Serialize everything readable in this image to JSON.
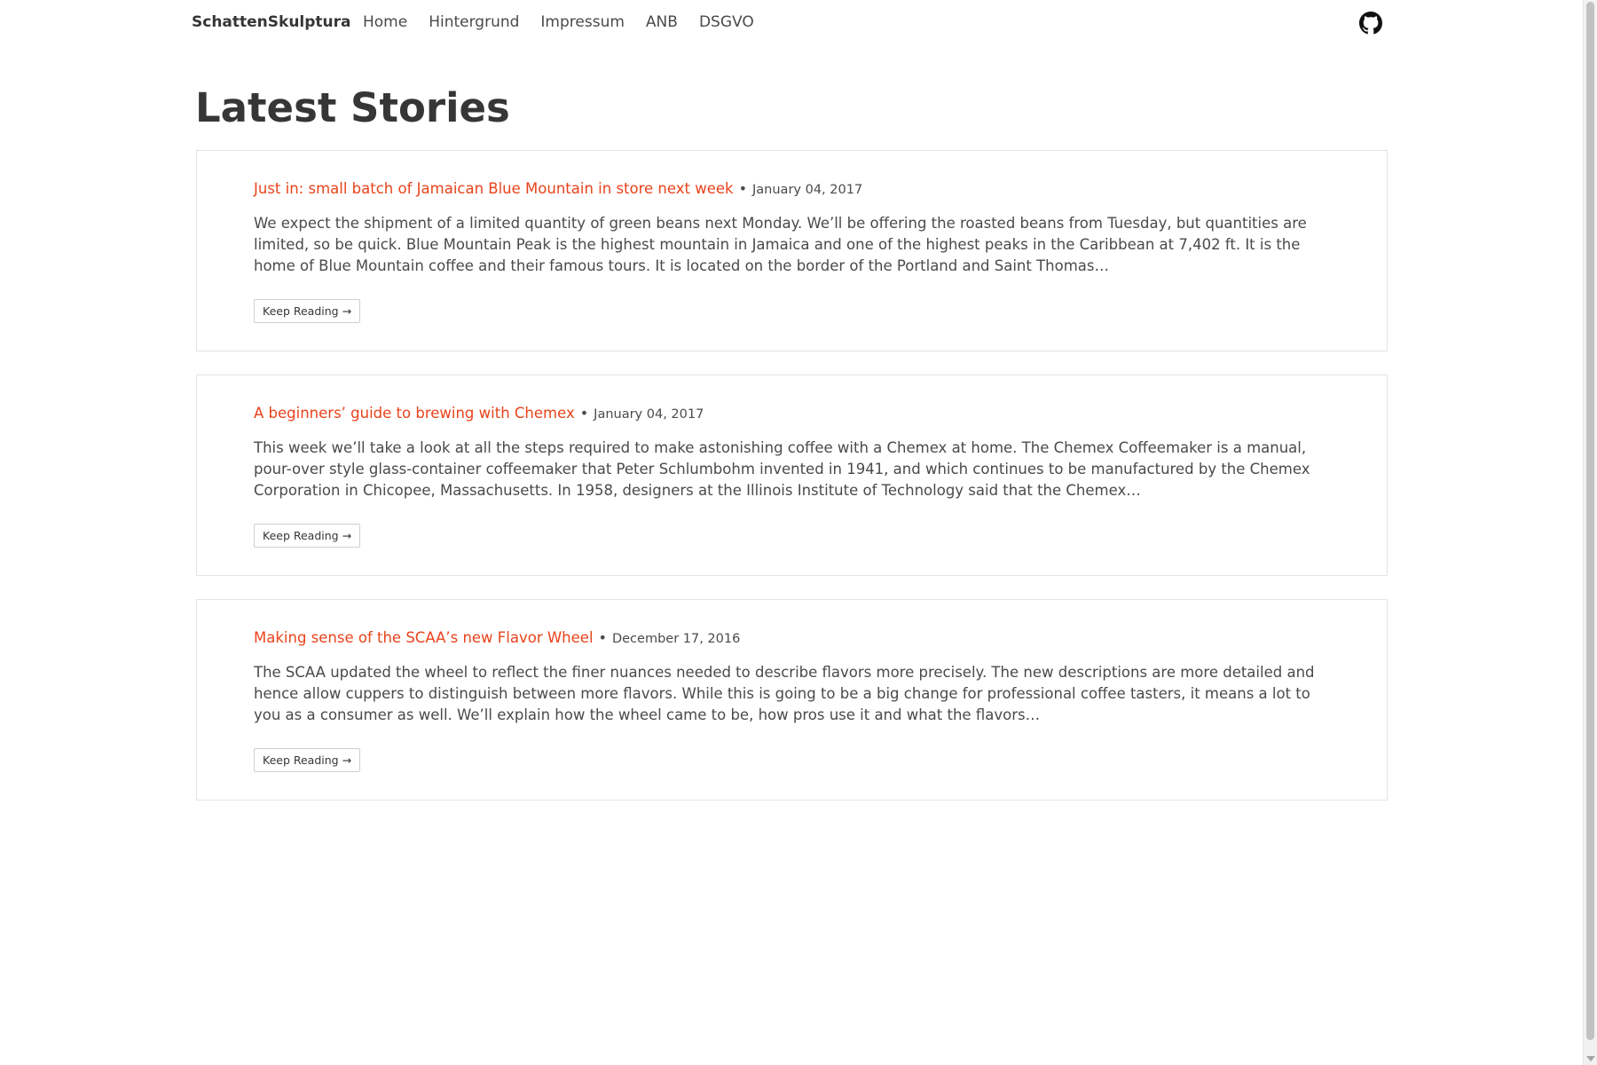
{
  "nav": {
    "brand": "SchattenSkulptura",
    "items": [
      {
        "label": "Home"
      },
      {
        "label": "Hintergrund"
      },
      {
        "label": "Impressum"
      },
      {
        "label": "ANB"
      },
      {
        "label": "DSGVO"
      }
    ],
    "github_icon": "github-icon"
  },
  "main": {
    "title": "Latest Stories",
    "posts": [
      {
        "title": "Just in: small batch of Jamaican Blue Mountain in store next week",
        "separator": "•",
        "date": "January 04, 2017",
        "excerpt": "We expect the shipment of a limited quantity of green beans next Monday. We’ll be offering the roasted beans from Tuesday, but quantities are limited, so be quick. Blue Mountain Peak is the highest mountain in Jamaica and one of the highest peaks in the Caribbean at 7,402 ft. It is the home of Blue Mountain coffee and their famous tours. It is located on the border of the Portland and Saint Thomas…",
        "button": "Keep Reading →"
      },
      {
        "title": "A beginners’ guide to brewing with Chemex",
        "separator": "•",
        "date": "January 04, 2017",
        "excerpt": "This week we’ll take a look at all the steps required to make astonishing coffee with a Chemex at home. The Chemex Coffeemaker is a manual, pour-over style glass-container coffeemaker that Peter Schlumbohm invented in 1941, and which continues to be manufactured by the Chemex Corporation in Chicopee, Massachusetts. In 1958, designers at the Illinois Institute of Technology said that the Chemex…",
        "button": "Keep Reading →"
      },
      {
        "title": "Making sense of the SCAA’s new Flavor Wheel",
        "separator": "•",
        "date": "December 17, 2016",
        "excerpt": "The SCAA updated the wheel to reflect the finer nuances needed to describe flavors more precisely. The new descriptions are more detailed and hence allow cuppers to distinguish between more flavors. While this is going to be a big change for professional coffee tasters, it means a lot to you as a consumer as well. We’ll explain how the wheel came to be, how pros use it and what the flavors…",
        "button": "Keep Reading →"
      }
    ]
  },
  "colors": {
    "link": "#e8431b",
    "text": "#4a4a4a",
    "heading": "#363636",
    "border": "#e4e4e4"
  }
}
